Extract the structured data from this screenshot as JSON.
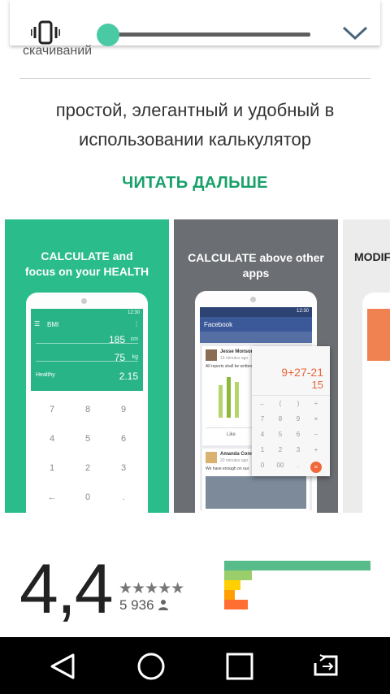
{
  "downloads_label": "скачиваний",
  "description": "простой, элегантный и удобный в использовании калькулятор",
  "read_more": "ЧИТАТЬ ДАЛЬШЕ",
  "volume": {
    "level": 0.05,
    "icon": "vibrate-icon",
    "expand_icon": "chevron-down-icon"
  },
  "screenshots": [
    {
      "caption_line1": "CALCULATE and",
      "caption_line2": "focus on your HEALTH",
      "time": "12:30",
      "app_title": "BMI",
      "height_value": "185",
      "height_unit": "cm",
      "weight_value": "75",
      "weight_unit": "kg",
      "status_label": "Healthy",
      "bmi_value": "2.15",
      "keys": [
        "7",
        "8",
        "9",
        "4",
        "5",
        "6",
        "1",
        "2",
        "3",
        "←",
        "0",
        "."
      ]
    },
    {
      "caption": "CALCULATE above other apps",
      "time": "12:30",
      "app_title": "Facebook",
      "post1_author": "Jesse Monson",
      "post1_time": "15 minutes ago",
      "post1_text": "All reports shall be written",
      "like_label": "Like",
      "post2_author": "Amanda Conno",
      "post2_time": "20 minutes ago",
      "post2_text": "We have enough on our",
      "calc_expression": "9+27-21",
      "calc_result": "15",
      "calc_keys": [
        "←",
        "(",
        ")",
        "÷",
        "7",
        "8",
        "9",
        "×",
        "4",
        "5",
        "6",
        "−",
        "1",
        "2",
        "3",
        "+",
        "0",
        "00",
        ".",
        "="
      ]
    },
    {
      "caption": "MODIFY"
    }
  ],
  "rating": {
    "value": "4,4",
    "stars": "★★★★★",
    "reviews": "5 936"
  },
  "rating_bars": [
    {
      "stars": 5,
      "fraction": 1.0,
      "color": "#57bb8a"
    },
    {
      "stars": 4,
      "fraction": 0.19,
      "color": "#9ace6a"
    },
    {
      "stars": 3,
      "fraction": 0.11,
      "color": "#ffcf02"
    },
    {
      "stars": 2,
      "fraction": 0.07,
      "color": "#ff9f02"
    },
    {
      "stars": 1,
      "fraction": 0.16,
      "color": "#ff6f31"
    }
  ],
  "navbar": [
    "back-icon",
    "home-icon",
    "recents-icon",
    "screen-rotate-icon"
  ]
}
